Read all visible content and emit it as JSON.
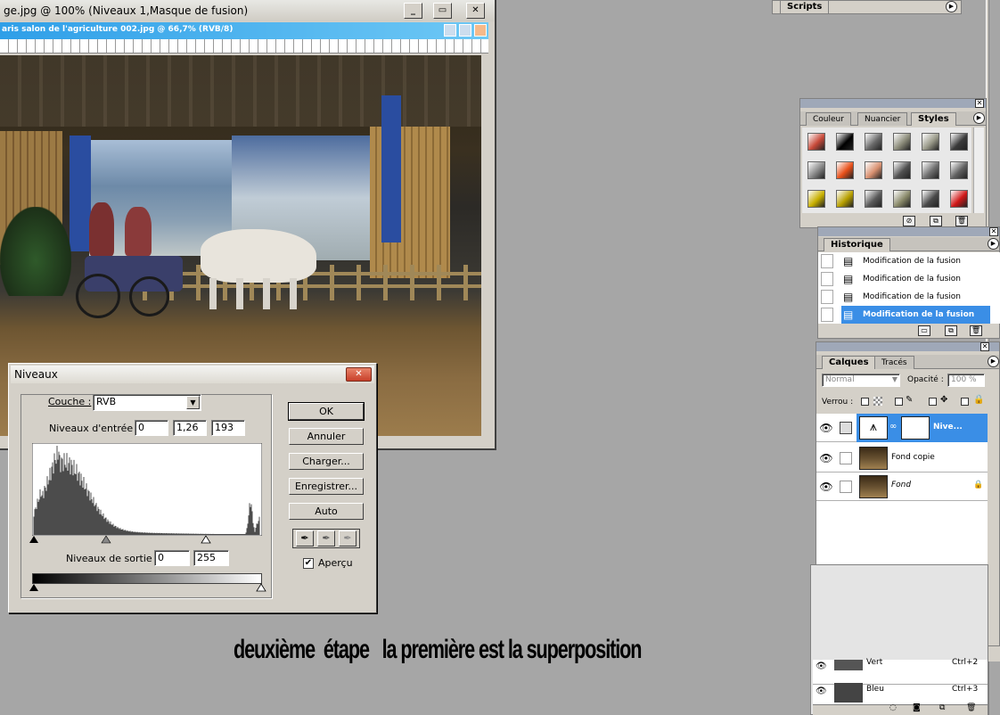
{
  "doc_window": {
    "title": "ge.jpg @ 100% (Niveaux 1,Masque de fusion)",
    "inner_title": "aris salon de l'agriculture 002.jpg @ 66,7% (RVB/8)"
  },
  "scripts_panel": {
    "tab": "Scripts"
  },
  "styles_panel": {
    "tabs": [
      "Couleur",
      "Nuancier",
      "Styles"
    ],
    "active_tab": "Styles",
    "swatch_colors": [
      "#c84a3a",
      "#000000",
      "#6a6a6a",
      "#8c8c7a",
      "#9a9a8a",
      "#3a3a3a",
      "#888888",
      "#e8501a",
      "#d89070",
      "#505050",
      "#707070",
      "#606060",
      "#c8b000",
      "#b8a000",
      "#5a5a5a",
      "#8a8a6a",
      "#4a4a4a",
      "#d01818"
    ]
  },
  "history_panel": {
    "tab": "Historique",
    "items": [
      "Modification de la fusion",
      "Modification de la fusion",
      "Modification de la fusion",
      "Modification de la fusion"
    ],
    "selected_index": 3
  },
  "layers_panel": {
    "tabs": [
      "Calques",
      "Tracés"
    ],
    "active_tab": "Calques",
    "blend_mode": "Normal",
    "opacity_label": "Opacité :",
    "opacity_value": "100 %",
    "lock_label": "Verrou :",
    "layers": [
      {
        "name": "Nive...",
        "selected": true
      },
      {
        "name": "Fond copie",
        "selected": false
      },
      {
        "name": "Fond",
        "selected": false,
        "italic": true,
        "locked": true
      }
    ]
  },
  "channels_panel": {
    "rows": [
      {
        "name": "Vert",
        "shortcut": "Ctrl+2"
      },
      {
        "name": "Bleu",
        "shortcut": "Ctrl+3"
      }
    ]
  },
  "levels_dialog": {
    "title": "Niveaux",
    "channel_label": "Couche :",
    "channel_value": "RVB",
    "input_label": "Niveaux d'entrée :",
    "input_values": [
      "0",
      "1,26",
      "193"
    ],
    "output_label": "Niveaux de sortie :",
    "output_values": [
      "0",
      "255"
    ],
    "buttons": [
      "OK",
      "Annuler",
      "Charger...",
      "Enregistrer...",
      "Auto"
    ],
    "preview_label": "Aperçu",
    "preview_checked": true
  },
  "caption": "deuxième  étape   la première est la superposition"
}
